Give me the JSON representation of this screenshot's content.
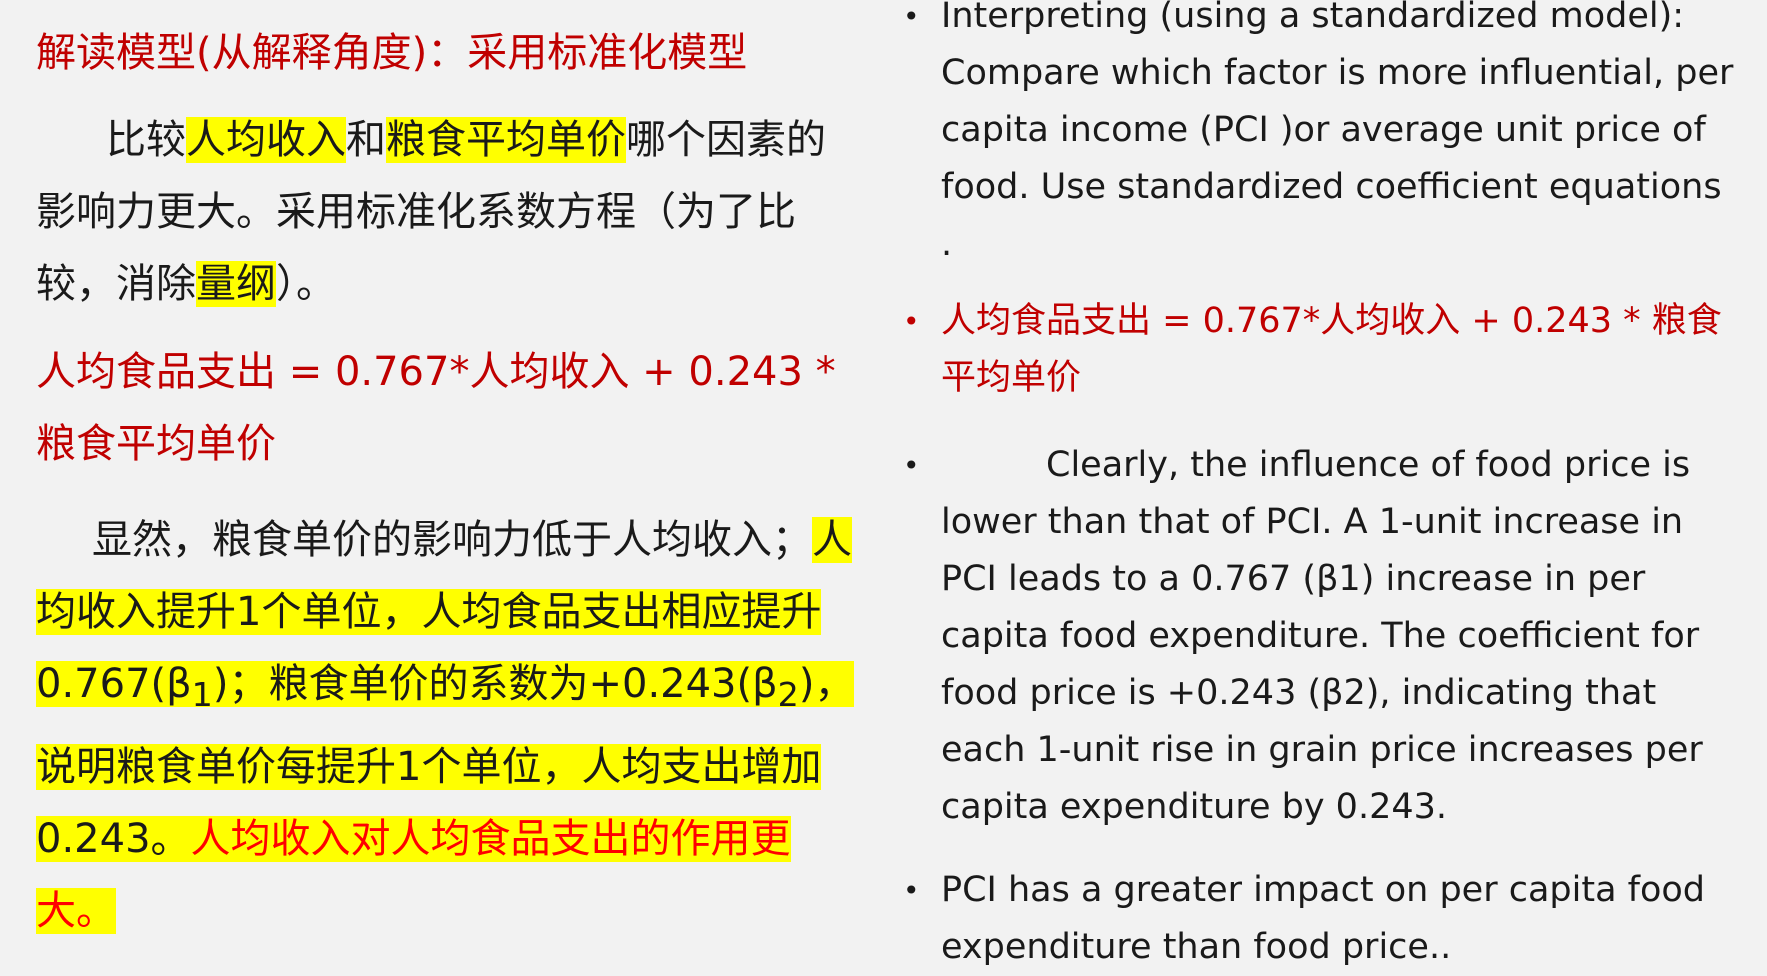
{
  "left": {
    "heading": "解读模型(从解释角度)：采用标准化模型",
    "p1": {
      "t1": "比较",
      "hl1": "人均收入",
      "t2": "和",
      "hl2": "粮食平均单价",
      "t3": "哪个因素的影响力更大。采用标准化系数方程（为了比较，消除",
      "hl3": "量纲",
      "t4": "）。"
    },
    "equation": "人均食品支出 = 0.767*人均收入 + 0.243 * 粮食平均单价",
    "p2": {
      "t1": "显然，粮食单价的影响力低于人均收入；",
      "hl1": "人均收入提升1个单位，人均食品支出相应提升0.767(β",
      "sub1": "1",
      "hl2": ")；粮食单价的系数为+0.243(β",
      "sub2": "2",
      "hl3": ")，说明粮食单价每提升1个单位，人均支出增加0.243。",
      "hl_red": "人均收入对人均食品支出的作用更大。"
    }
  },
  "right": {
    "bullet_char": "•",
    "b1": "Interpreting (using a standardized model): Compare which factor is more influential, per capita income (PCI )or average unit price of food. Use standardized coefficient equations .",
    "b2": "人均食品支出 = 0.767*人均收入 + 0.243 * 粮食平均单价",
    "b3": "Clearly, the influence of food price is lower than that of PCI. A 1-unit increase in PCI leads to a 0.767 (β1) increase in per capita food expenditure. The coefficient for food price is +0.243 (β2), indicating that each 1-unit rise in grain price increases per capita expenditure by 0.243.",
    "b4": "PCI has a greater impact on per capita food expenditure than food  price.."
  },
  "colors": {
    "background": "#f2f2f2",
    "text": "#1a1a1a",
    "dark_red": "#c00000",
    "red": "#ff0000",
    "highlight": "#ffff00"
  }
}
